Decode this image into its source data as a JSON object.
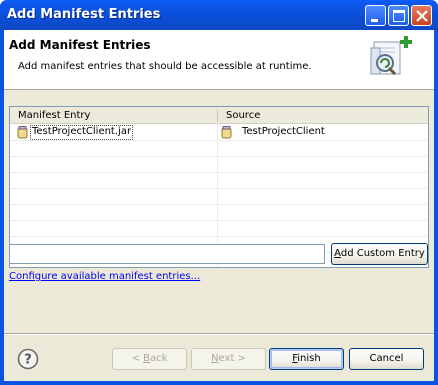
{
  "window": {
    "title": "Add Manifest Entries",
    "controls": {
      "minimize": "minimize",
      "maximize": "maximize",
      "close": "close"
    }
  },
  "header": {
    "title": "Add Manifest Entries",
    "description": "Add manifest entries that should be accessible at runtime."
  },
  "table": {
    "columns": [
      "Manifest Entry",
      "Source"
    ],
    "rows": [
      {
        "entry": "TestProjectClient.jar",
        "source": "TestProjectClient"
      }
    ]
  },
  "entry_input": {
    "value": ""
  },
  "buttons": {
    "add_custom_mnemonic": "A",
    "add_custom_rest": "dd Custom Entry",
    "back_prefix": "< ",
    "back_mnemonic": "B",
    "back_rest": "ack",
    "next_mnemonic": "N",
    "next_rest": "ext >",
    "finish_mnemonic": "F",
    "finish_rest": "inish",
    "cancel": "Cancel"
  },
  "link": {
    "configure": "Configure available manifest entries..."
  },
  "state": {
    "back_enabled": false,
    "next_enabled": false,
    "default_button": "Finish"
  },
  "colors": {
    "titlebar": "#0a55e3",
    "dialog_bg": "#ece9d8",
    "link": "#0000ff"
  }
}
